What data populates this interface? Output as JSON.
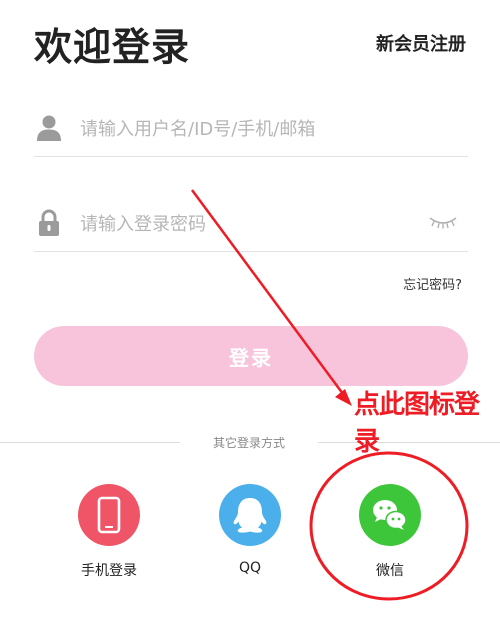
{
  "header": {
    "title": "欢迎登录",
    "register_label": "新会员注册"
  },
  "form": {
    "username_placeholder": "请输入用户名/ID号/手机/邮箱",
    "password_placeholder": "请输入登录密码",
    "forgot_label": "忘记密码?",
    "login_label": "登录"
  },
  "other_login": {
    "divider_label": "其它登录方式",
    "options": [
      {
        "label": "手机登录",
        "icon": "phone-icon",
        "color": "#ef5567"
      },
      {
        "label": "QQ",
        "icon": "qq-penguin-icon",
        "color": "#4aafea"
      },
      {
        "label": "微信",
        "icon": "wechat-icon",
        "color": "#3ec63b"
      }
    ]
  },
  "annotation": {
    "text": "点此图标登录",
    "color": "#ee1c24"
  },
  "colors": {
    "login_button": "#f7c4dc"
  }
}
